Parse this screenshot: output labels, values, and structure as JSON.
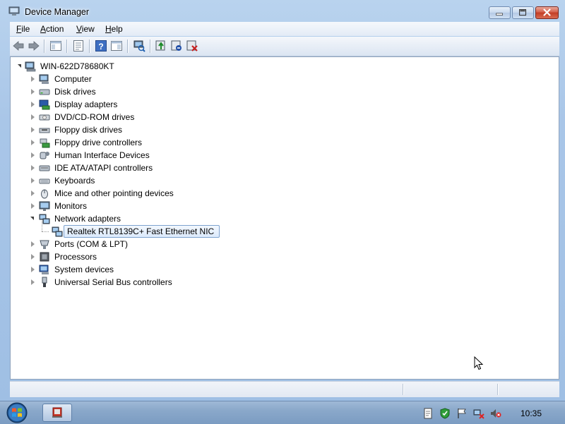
{
  "window": {
    "title": "Device Manager",
    "caption_buttons": [
      "minimize",
      "maximize",
      "close"
    ]
  },
  "menubar": {
    "items": [
      {
        "label": "File",
        "accel": "F",
        "rest": "ile"
      },
      {
        "label": "Action",
        "accel": "A",
        "rest": "ction"
      },
      {
        "label": "View",
        "accel": "V",
        "rest": "iew"
      },
      {
        "label": "Help",
        "accel": "H",
        "rest": "elp"
      }
    ]
  },
  "toolbar": {
    "buttons": [
      "back-arrow-icon",
      "forward-arrow-icon",
      "show-hide-console-tree-icon",
      "properties-icon",
      "help-icon",
      "show-hide-action-pane-icon",
      "scan-hardware-icon",
      "update-driver-icon",
      "disable-device-icon",
      "uninstall-device-icon"
    ]
  },
  "tree": {
    "root": "WIN-622D78680KT",
    "categories": [
      {
        "label": "Computer",
        "icon": "computer-icon",
        "expanded": false
      },
      {
        "label": "Disk drives",
        "icon": "disk-drive-icon",
        "expanded": false
      },
      {
        "label": "Display adapters",
        "icon": "display-adapter-icon",
        "expanded": false
      },
      {
        "label": "DVD/CD-ROM drives",
        "icon": "dvd-drive-icon",
        "expanded": false
      },
      {
        "label": "Floppy disk drives",
        "icon": "floppy-drive-icon",
        "expanded": false
      },
      {
        "label": "Floppy drive controllers",
        "icon": "floppy-controller-icon",
        "expanded": false
      },
      {
        "label": "Human Interface Devices",
        "icon": "hid-icon",
        "expanded": false
      },
      {
        "label": "IDE ATA/ATAPI controllers",
        "icon": "ide-controller-icon",
        "expanded": false
      },
      {
        "label": "Keyboards",
        "icon": "keyboard-icon",
        "expanded": false
      },
      {
        "label": "Mice and other pointing devices",
        "icon": "mouse-icon",
        "expanded": false
      },
      {
        "label": "Monitors",
        "icon": "monitor-icon",
        "expanded": false
      },
      {
        "label": "Network adapters",
        "icon": "network-adapter-icon",
        "expanded": true
      },
      {
        "label": "Realtek RTL8139C+ Fast Ethernet NIC",
        "icon": "network-card-icon",
        "child": true,
        "selected": true
      },
      {
        "label": "Ports (COM & LPT)",
        "icon": "port-icon",
        "expanded": false
      },
      {
        "label": "Processors",
        "icon": "processor-icon",
        "expanded": false
      },
      {
        "label": "System devices",
        "icon": "system-device-icon",
        "expanded": false
      },
      {
        "label": "Universal Serial Bus controllers",
        "icon": "usb-controller-icon",
        "expanded": false
      }
    ]
  },
  "taskbar": {
    "clock": "10:35",
    "tray_icons": [
      "action-center-icon",
      "security-shield-icon",
      "flag-icon",
      "network-disconnected-icon",
      "volume-muted-icon"
    ]
  },
  "colors": {
    "selection_border": "#7da2ce",
    "selection_fill": "#dceafc",
    "window_frame": "#a9c6e8"
  }
}
